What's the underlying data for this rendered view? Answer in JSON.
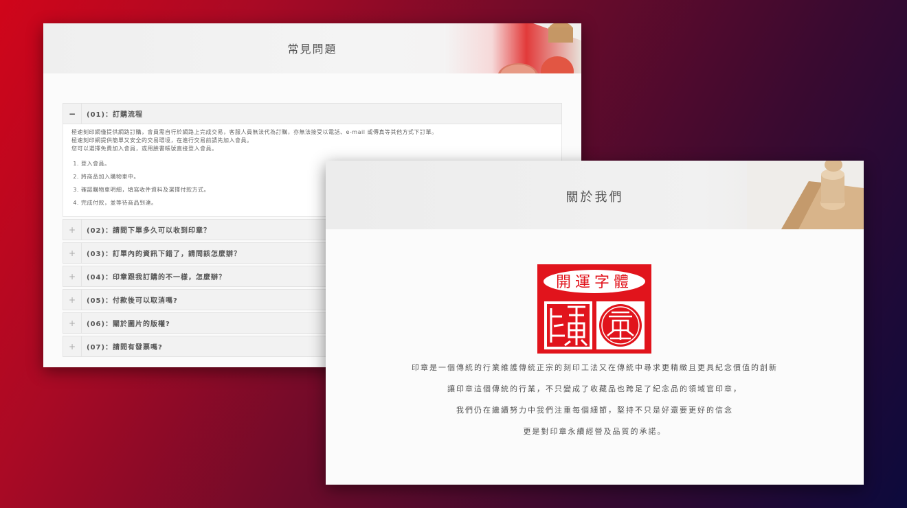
{
  "faq": {
    "title": "常見問題",
    "items": [
      {
        "question": "(01)：訂購流程",
        "open": true
      },
      {
        "question": "(02)：請問下單多久可以收到印章？"
      },
      {
        "question": "(03)：訂單內的資訊下錯了，請問該怎麼辦？"
      },
      {
        "question": "(04)：印章跟我訂購的不一樣，怎麼辦？"
      },
      {
        "question": "(05)：付款後可以取消嗎?"
      },
      {
        "question": "(06)：關於圖片的版權?"
      },
      {
        "question": "(07)：請問有發票嗎?"
      }
    ],
    "open_answer": {
      "lines": [
        "極速刻印網僅提供網路訂購，會員需自行於網路上完成交易，客服人員無法代為訂購，亦無法接受以電話、e-mail 或傳真等其他方式下訂單。",
        "極速刻印網提供簡單又安全的交易環境，在進行交易前請先加入會員。",
        "您可以選擇免費加入會員，或用臉書帳號直接登入會員。"
      ],
      "steps": [
        "登入會員。",
        "將商品加入購物車中。",
        "確認購物車明細，填寫收件資料及選擇付款方式。",
        "完成付款，並等待商品到達。"
      ]
    },
    "icons": {
      "open": "minus-icon",
      "closed": "plus-icon"
    }
  },
  "about": {
    "title": "關於我們",
    "logo": {
      "top_text": "開運字體"
    },
    "paragraphs": [
      "印章是一個傳統的行業維護傳統正宗的刻印工法又在傳統中尋求更精緻且更具紀念價值的創新",
      "讓印章這個傳統的行業，不只變成了收藏品也跨足了紀念品的領域官印章，",
      "我們仍在繼續努力中我們注重每個細節，堅持不只是好還要更好的信念",
      "更是對印章永續經營及品質的承諾。"
    ]
  },
  "colors": {
    "seal_red": "#e1141c",
    "bg_start": "#d0051a",
    "bg_end": "#0c0a3c"
  }
}
